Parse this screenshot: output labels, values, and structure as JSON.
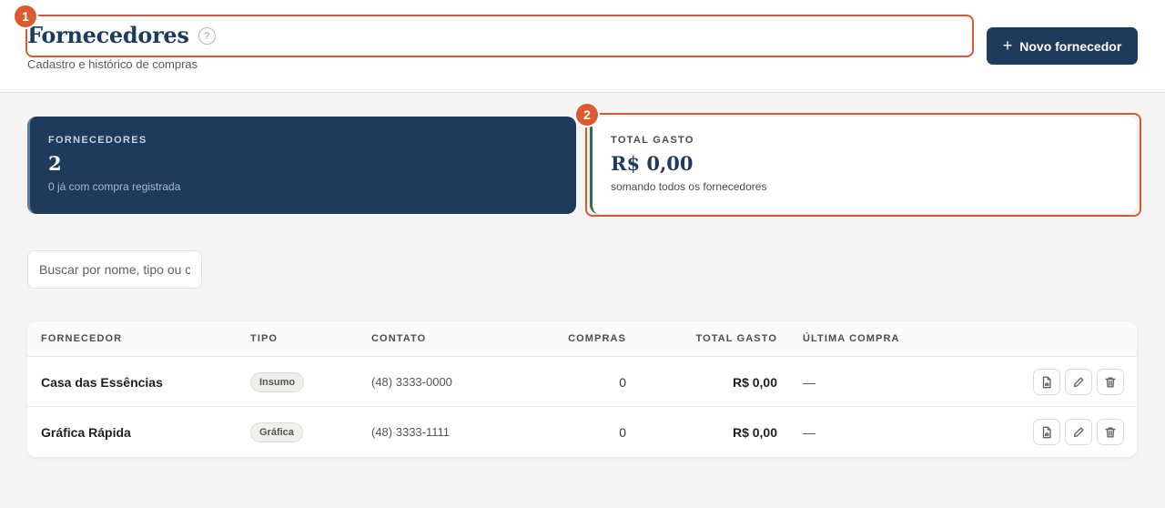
{
  "header": {
    "title": "Fornecedores",
    "help_glyph": "?",
    "subtitle": "Cadastro e histórico de compras",
    "new_button_label": "Novo fornecedor",
    "new_button_icon": "+"
  },
  "annotations": [
    "1",
    "2"
  ],
  "stats": {
    "suppliers": {
      "label": "FORNECEDORES",
      "value": "2",
      "note": "0 já com compra registrada"
    },
    "total_spent": {
      "label": "TOTAL GASTO",
      "value": "R$ 0,00",
      "note": "somando todos os fornecedores"
    }
  },
  "search": {
    "placeholder": "Buscar por nome, tipo ou contato...",
    "value": ""
  },
  "table": {
    "columns": [
      "FORNECEDOR",
      "TIPO",
      "CONTATO",
      "COMPRAS",
      "TOTAL GASTO",
      "ÚLTIMA COMPRA"
    ],
    "rows": [
      {
        "name": "Casa das Essências",
        "tipo": "Insumo",
        "contato": "(48) 3333-0000",
        "compras": "0",
        "total": "R$ 0,00",
        "ultima": "—"
      },
      {
        "name": "Gráfica Rápida",
        "tipo": "Gráfica",
        "contato": "(48) 3333-1111",
        "compras": "0",
        "total": "R$ 0,00",
        "ultima": "—"
      }
    ],
    "row_actions": [
      "report-icon",
      "edit-icon",
      "delete-icon"
    ]
  },
  "colors": {
    "brand_navy": "#1e3a5c",
    "annotation_orange": "#dc5a30",
    "accent_green": "#2d6b52",
    "background": "#f5f4f3"
  }
}
